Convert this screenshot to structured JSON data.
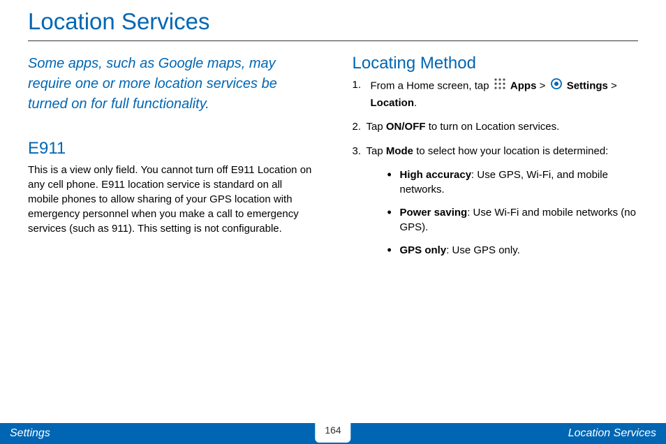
{
  "title": "Location Services",
  "intro": "Some apps, such as Google maps, may require one or more location services be turned on for full functionality.",
  "e911": {
    "heading": "E911",
    "body": "This is a view only field. You cannot turn off E911 Location on any cell phone. E911 location service is standard on all mobile phones to allow sharing of your GPS location with emergency personnel when you make a call to emergency services (such as 911). This setting is not configurable."
  },
  "locating": {
    "heading": "Locating Method",
    "steps": {
      "s1_prefix": "From a Home screen, tap ",
      "s1_apps": "Apps",
      "s1_gt1": " > ",
      "s1_settings": "Settings",
      "s1_gt2": " > ",
      "s1_location": "Location",
      "s1_period": ".",
      "s2_prefix": "Tap ",
      "s2_onoff": "ON/OFF",
      "s2_suffix": " to turn on Location services.",
      "s3_prefix": "Tap ",
      "s3_mode": "Mode",
      "s3_suffix": " to select how your location is determined:"
    },
    "bullets": {
      "b1_label": "High accuracy",
      "b1_text": ": Use GPS, Wi-Fi, and mobile networks.",
      "b2_label": "Power saving",
      "b2_text": ": Use Wi-Fi and mobile networks (no GPS).",
      "b3_label": "GPS only",
      "b3_text": ": Use GPS only."
    }
  },
  "footer": {
    "left": "Settings",
    "page": "164",
    "right": "Location Services"
  }
}
